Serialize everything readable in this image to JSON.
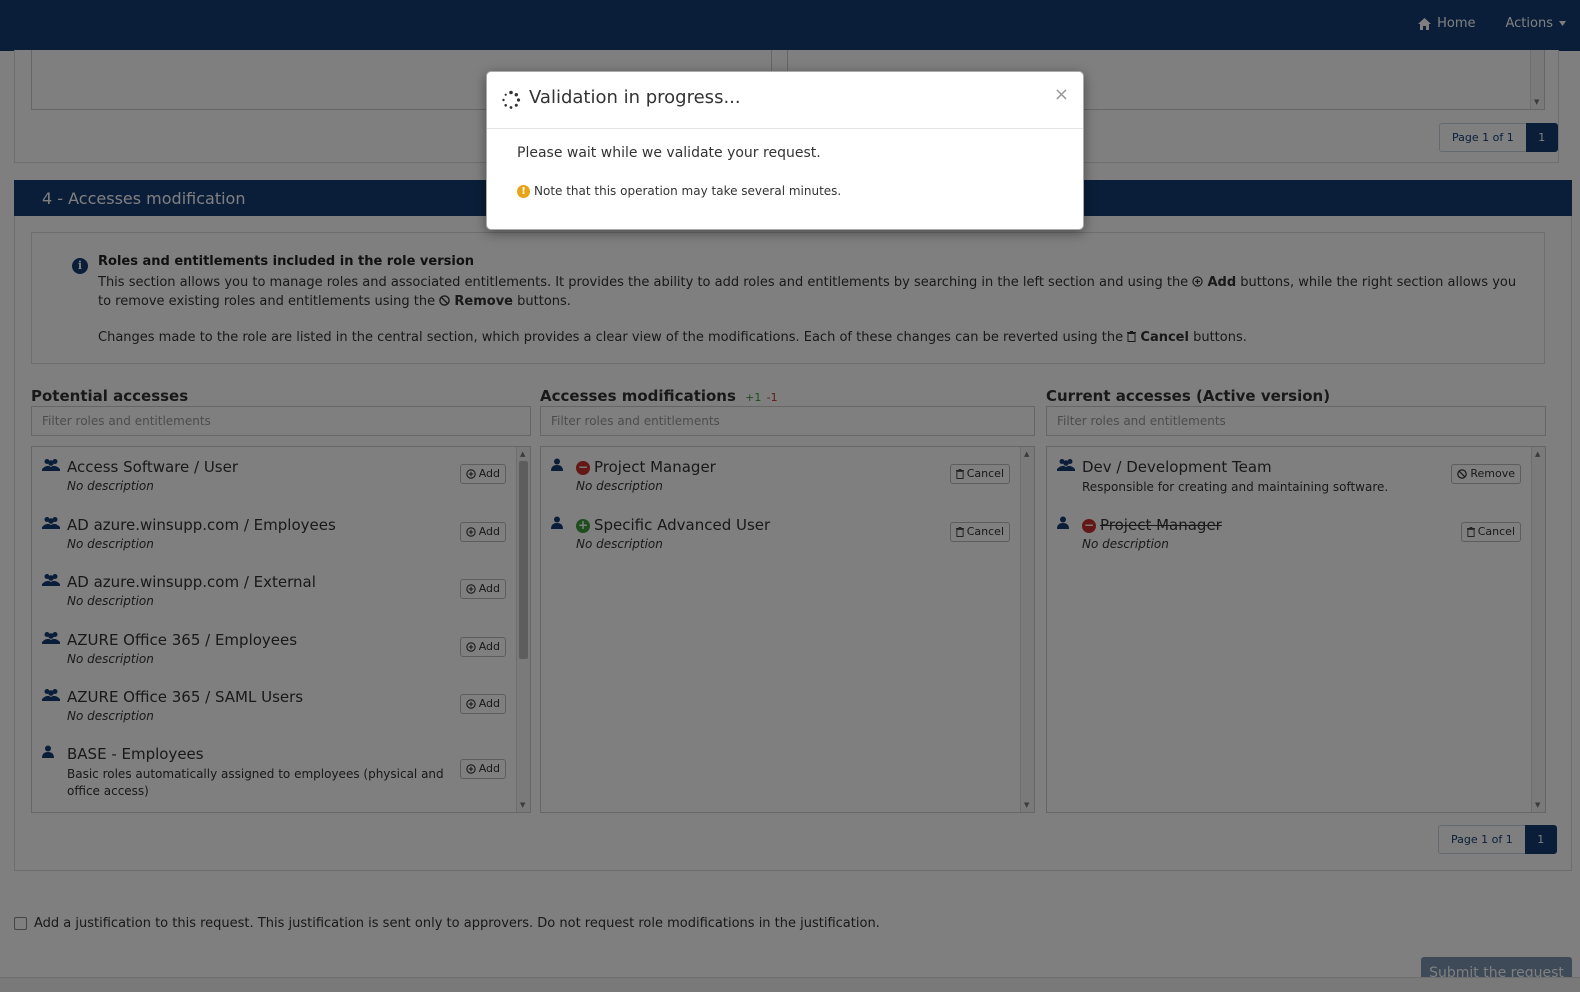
{
  "topbar": {
    "home_label": "Home",
    "actions_label": "Actions"
  },
  "top_pager": {
    "info": "Page 1 of 1",
    "page": "1"
  },
  "section": {
    "title": "4 - Accesses modification",
    "info": {
      "title": "Roles and entitlements included in the role version",
      "p1_a": "This section allows you to manage roles and associated entitlements. It provides the ability to add roles and entitlements by searching in the left section and using the",
      "p1_add": "Add",
      "p1_b": "buttons, while the right section allows you to remove existing roles and entitlements using the",
      "p1_remove": "Remove",
      "p1_c": "buttons.",
      "p2_a": "Changes made to the role are listed in the central section, which provides a clear view of the modifications. Each of these changes can be reverted using the",
      "p2_cancel": "Cancel",
      "p2_b": "buttons."
    },
    "potential": {
      "title": "Potential accesses",
      "placeholder": "Filter roles and entitlements",
      "items": [
        {
          "name": "Access Software / User",
          "desc": "No description",
          "button": "Add"
        },
        {
          "name": "AD azure.winsupp.com / Employees",
          "desc": "No description",
          "button": "Add"
        },
        {
          "name": "AD azure.winsupp.com / External",
          "desc": "No description",
          "button": "Add"
        },
        {
          "name": "AZURE Office 365 / Employees",
          "desc": "No description",
          "button": "Add"
        },
        {
          "name": "AZURE Office 365 / SAML Users",
          "desc": "No description",
          "button": "Add"
        },
        {
          "name": "BASE - Employees",
          "desc": "Basic roles automatically assigned to employees (physical and office access)",
          "button": "Add"
        }
      ]
    },
    "modifications": {
      "title": "Accesses modifications",
      "plus": "+1",
      "minus": "-1",
      "placeholder": "Filter roles and entitlements",
      "items": [
        {
          "name": "Project Manager",
          "desc": "No description",
          "button": "Cancel"
        },
        {
          "name": "Specific Advanced User",
          "desc": "No description",
          "button": "Cancel"
        }
      ]
    },
    "current": {
      "title": "Current accesses (Active version)",
      "placeholder": "Filter roles and entitlements",
      "items": [
        {
          "name": "Dev / Development Team",
          "desc": "Responsible for creating and maintaining software.",
          "button": "Remove"
        },
        {
          "name": "Project Manager",
          "desc": "No description",
          "button": "Cancel"
        }
      ]
    },
    "pager": {
      "info": "Page 1 of 1",
      "page": "1"
    }
  },
  "justification_label": "Add a justification to this request. This justification is sent only to approvers. Do not request role modifications in the justification.",
  "submit_label": "Submit the request",
  "modal": {
    "title": "Validation in progress...",
    "close": "×",
    "message": "Please wait while we validate your request.",
    "note": "Note that this operation may take several minutes."
  },
  "colors": {
    "brand": "#153d73",
    "remove": "#c9302c",
    "add": "#3c9a3c",
    "warning": "#e8a317"
  }
}
